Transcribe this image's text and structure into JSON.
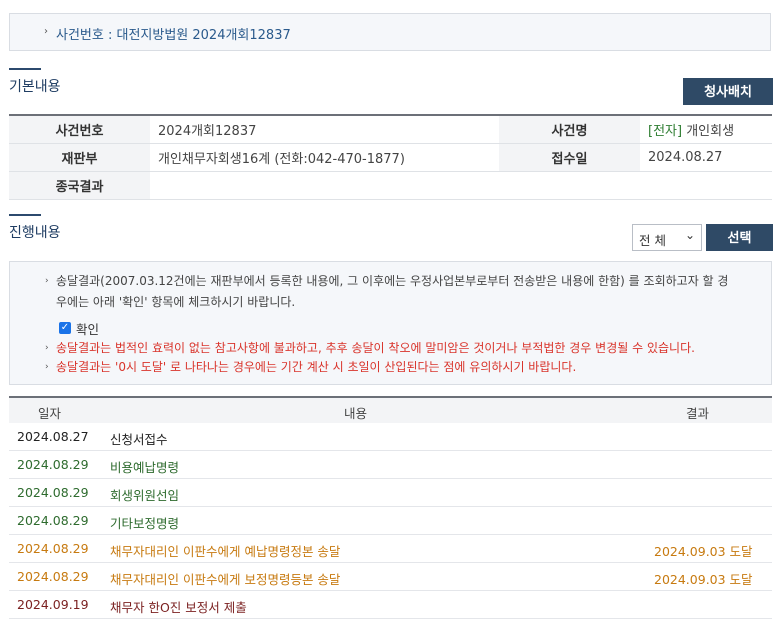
{
  "case_box": {
    "text": "사건번호 : 대전지방법원 2024개회12837"
  },
  "basic": {
    "title": "기본내용",
    "button": "청사배치",
    "case_no_label": "사건번호",
    "case_no": "2024개회12837",
    "case_name_label": "사건명",
    "case_name_tag": "[전자]",
    "case_name": "개인회생",
    "court_label": "재판부",
    "court": "개인채무자회생16계 (전화:042-470-1877)",
    "filed_label": "접수일",
    "filed": "2024.08.27",
    "result_label": "종국결과",
    "result": ""
  },
  "progress": {
    "title": "진행내용",
    "filter_value": "전 체",
    "select_button": "선택",
    "notice_line1": "송달결과(2007.03.12건에는 재판부에서 등록한 내용에, 그 이후에는 우정사업본부로부터 전송받은 내용에 한함) 를 조회하고자 할 경",
    "notice_line2": "우에는 아래 '확인' 항목에 체크하시기 바랍니다.",
    "confirm_label": "확인",
    "warn1": "송달결과는 법적인 효력이 없는 참고사항에 불과하고, 추후 송달이 착오에 말미암은 것이거나 부적법한 경우 변경될 수 있습니다.",
    "warn2": "송달결과는 '0시 도달' 로 나타나는 경우에는 기간 계산 시 초일이 산입된다는 점에 유의하시기 바랍니다.",
    "headers": {
      "date": "일자",
      "content": "내용",
      "result": "결과"
    },
    "rows": [
      {
        "date": "2024.08.27",
        "content": "신청서접수",
        "result": ""
      },
      {
        "date": "2024.08.29",
        "content": "비용예납명령",
        "result": ""
      },
      {
        "date": "2024.08.29",
        "content": "회생위원선임",
        "result": ""
      },
      {
        "date": "2024.08.29",
        "content": "기타보정명령",
        "result": ""
      },
      {
        "date": "2024.08.29",
        "content": "채무자대리인 이판수에게 예납명령정본 송달",
        "result": "2024.09.03 도달"
      },
      {
        "date": "2024.08.29",
        "content": "채무자대리인 이판수에게 보정명령등본 송달",
        "result": "2024.09.03 도달"
      },
      {
        "date": "2024.09.19",
        "content": "채무자 한O진 보정서 제출",
        "result": ""
      }
    ]
  },
  "colors": {
    "accent_dark": "#2f4a66",
    "warn_red": "#d9342b",
    "row_green": "#2e6b2e",
    "row_orange": "#c77a10",
    "row_maroon": "#7a1f1f"
  }
}
